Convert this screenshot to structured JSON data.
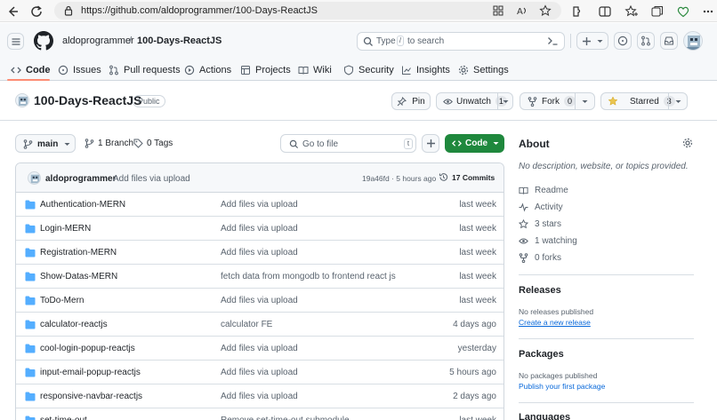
{
  "browser": {
    "url": "https://github.com/aldoprogrammer/100-Days-ReactJS"
  },
  "header": {
    "owner": "aldoprogrammer",
    "slash": "/",
    "repo": "100-Days-ReactJS",
    "search_prefix": "Type",
    "search_key": "/",
    "search_suffix": "to search"
  },
  "nav_tabs": [
    {
      "label": "Code",
      "icon": "code-icon"
    },
    {
      "label": "Issues",
      "icon": "issue-icon"
    },
    {
      "label": "Pull requests",
      "icon": "pull-request-icon"
    },
    {
      "label": "Actions",
      "icon": "play-icon"
    },
    {
      "label": "Projects",
      "icon": "table-icon"
    },
    {
      "label": "Wiki",
      "icon": "book-icon"
    },
    {
      "label": "Security",
      "icon": "shield-icon"
    },
    {
      "label": "Insights",
      "icon": "graph-icon"
    },
    {
      "label": "Settings",
      "icon": "gear-icon"
    }
  ],
  "repo": {
    "name": "100-Days-ReactJS",
    "visibility": "Public",
    "pin_label": "Pin",
    "watch_label": "Unwatch",
    "watch_count": "1",
    "fork_label": "Fork",
    "fork_count": "0",
    "star_label": "Starred",
    "star_count": "3"
  },
  "toolbar": {
    "branch": "main",
    "branches": "1 Branch",
    "tags": "0 Tags",
    "goto_placeholder": "Go to file",
    "goto_key": "t",
    "code_label": "Code"
  },
  "commit": {
    "author": "aldoprogrammer",
    "message": "Add files via upload",
    "meta": "19a46fd · 5 hours ago",
    "commits": "17 Commits"
  },
  "files": [
    {
      "name": "Authentication-MERN",
      "message": "Add files via upload",
      "date": "last week"
    },
    {
      "name": "Login-MERN",
      "message": "Add files via upload",
      "date": "last week"
    },
    {
      "name": "Registration-MERN",
      "message": "Add files via upload",
      "date": "last week"
    },
    {
      "name": "Show-Datas-MERN",
      "message": "fetch data from mongodb to frontend react js",
      "date": "last week"
    },
    {
      "name": "ToDo-Mern",
      "message": "Add files via upload",
      "date": "last week"
    },
    {
      "name": "calculator-reactjs",
      "message": "calculator FE",
      "date": "4 days ago"
    },
    {
      "name": "cool-login-popup-reactjs",
      "message": "Add files via upload",
      "date": "yesterday"
    },
    {
      "name": "input-email-popup-reactjs",
      "message": "Add files via upload",
      "date": "5 hours ago"
    },
    {
      "name": "responsive-navbar-reactjs",
      "message": "Add files via upload",
      "date": "2 days ago"
    },
    {
      "name": "set-time-out",
      "message": "Remove set-time-out submodule",
      "date": "last week"
    }
  ],
  "about": {
    "title": "About",
    "description": "No description, website, or topics provided.",
    "items": [
      {
        "label": "Readme",
        "icon": "book-icon"
      },
      {
        "label": "Activity",
        "icon": "pulse-icon"
      },
      {
        "label": "3 stars",
        "icon": "star-icon"
      },
      {
        "label": "1 watching",
        "icon": "eye-icon"
      },
      {
        "label": "0 forks",
        "icon": "fork-icon"
      }
    ]
  },
  "releases": {
    "title": "Releases",
    "empty": "No releases published",
    "link": "Create a new release"
  },
  "packages": {
    "title": "Packages",
    "empty": "No packages published",
    "link": "Publish your first package"
  },
  "languages": {
    "title": "Languages"
  },
  "colors": {
    "accent_green": "#1f883d",
    "link_blue": "#0969da",
    "folder_blue": "#54aeff",
    "tab_underline": "#fd8c73",
    "star_yellow": "#eac54f"
  }
}
